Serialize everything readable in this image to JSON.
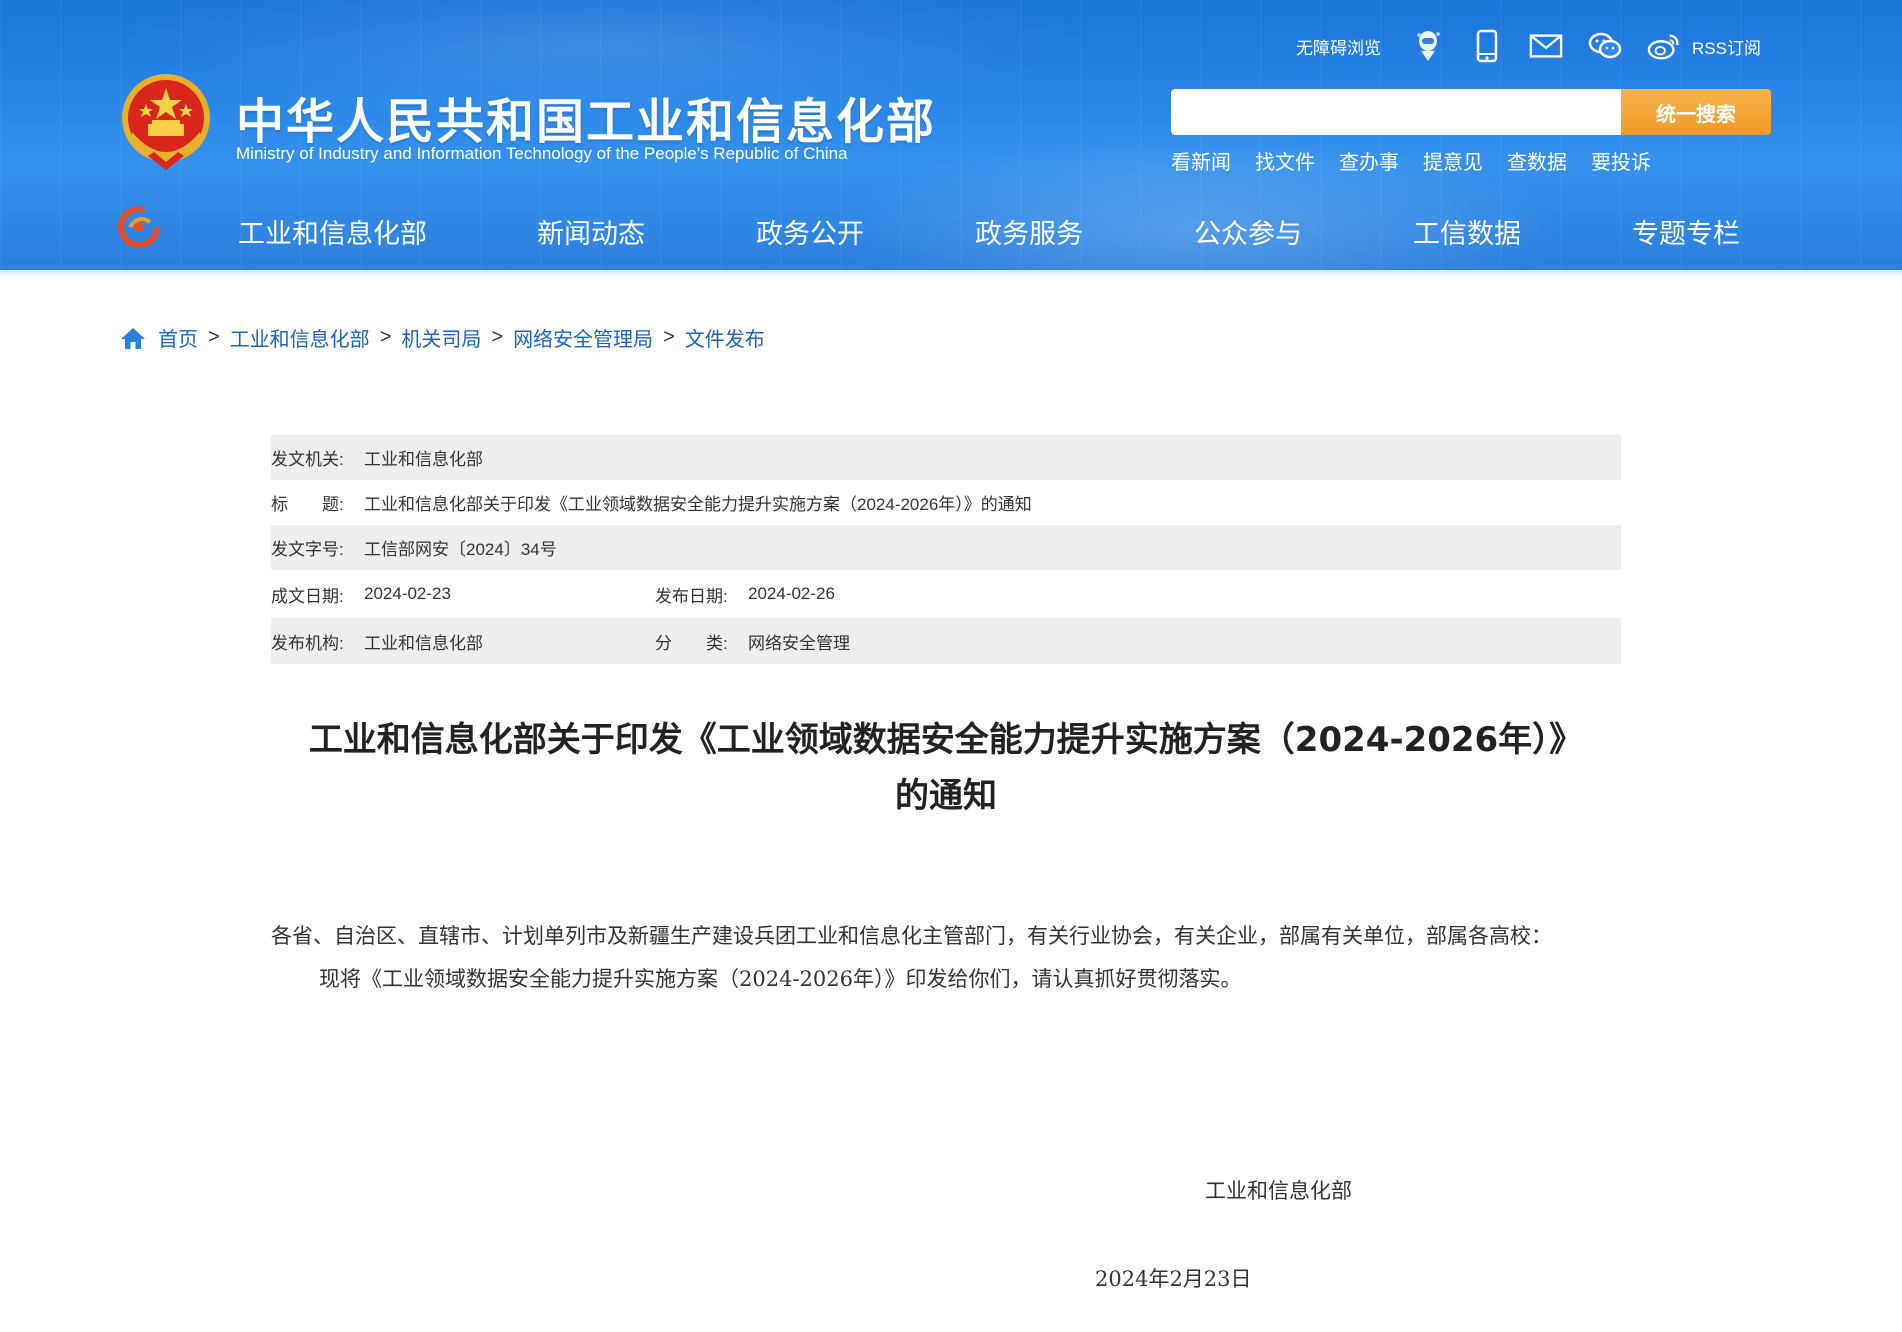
{
  "header": {
    "title_cn": "中华人民共和国工业和信息化部",
    "title_en": "Ministry of Industry and Information Technology of the People's Republic of China",
    "accessibility": "无障碍浏览",
    "rss": "RSS订阅",
    "search_placeholder": "",
    "search_button": "统一搜索",
    "quicklinks": [
      "看新闻",
      "找文件",
      "查办事",
      "提意见",
      "查数据",
      "要投诉"
    ],
    "icons": [
      "robot-assistant-icon",
      "mobile-icon",
      "mail-icon",
      "wechat-icon",
      "weibo-icon"
    ]
  },
  "nav": {
    "items": [
      "工业和信息化部",
      "新闻动态",
      "政务公开",
      "政务服务",
      "公众参与",
      "工信数据",
      "专题专栏"
    ]
  },
  "breadcrumb": {
    "items": [
      "首页",
      "工业和信息化部",
      "机关司局",
      "网络安全管理局",
      "文件发布"
    ],
    "separator": ">"
  },
  "info": {
    "issuer_label": "发文机关:",
    "issuer": "工业和信息化部",
    "title_label": "标　　题:",
    "title": "工业和信息化部关于印发《工业领域数据安全能力提升实施方案（2024-2026年）》的通知",
    "docno_label": "发文字号:",
    "docno": "工信部网安〔2024〕34号",
    "created_label": "成文日期:",
    "created": "2024-02-23",
    "published_label": "发布日期:",
    "published": "2024-02-26",
    "org_label": "发布机构:",
    "org": "工业和信息化部",
    "category_label": "分　　类:",
    "category": "网络安全管理"
  },
  "article": {
    "title_line1": "工业和信息化部关于印发《工业领域数据安全能力提升实施方案（2024-2026年）》",
    "title_line2": "的通知",
    "salutation": "各省、自治区、直辖市、计划单列市及新疆生产建设兵团工业和信息化主管部门，有关行业协会，有关企业，部属有关单位，部属各高校：",
    "body": "现将《工业领域数据安全能力提升实施方案（2024-2026年）》印发给你们，请认真抓好贯彻落实。",
    "sign_org": "工业和信息化部",
    "sign_date": "2024年2月23日"
  },
  "colors": {
    "header_blue": "#2a86e6",
    "search_orange": "#ef9a26",
    "link_blue": "#1b62c4",
    "row_shade": "#eeeeee"
  }
}
